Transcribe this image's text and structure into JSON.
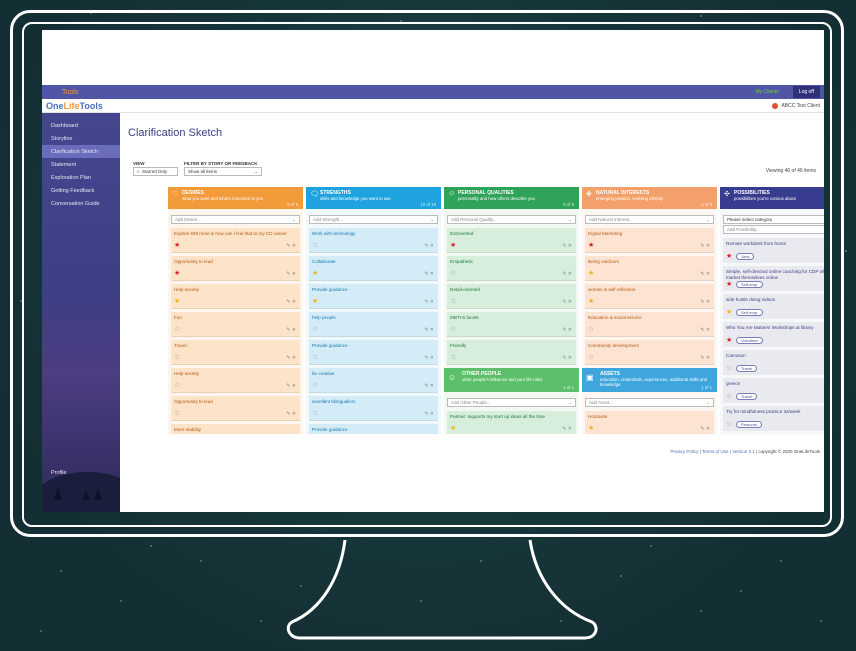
{
  "topbar": {
    "my_clients": "My Clients",
    "logoff": "Log off",
    "swoosh_text": "Tools"
  },
  "brand": {
    "one": "One",
    "life": "Life",
    "tools": "Tools",
    "user": "ABCC Test Client"
  },
  "sidebar": {
    "items": [
      {
        "label": "Dashboard"
      },
      {
        "label": "Storyline"
      },
      {
        "label": "Clarification Sketch"
      },
      {
        "label": "Statement"
      },
      {
        "label": "Exploration Plan"
      },
      {
        "label": "Getting Feedback"
      },
      {
        "label": "Conversation Guide"
      }
    ],
    "profile": "Profile"
  },
  "page": {
    "title": "Clarification Sketch",
    "view_label": "VIEW",
    "filter_label": "FILTER BY STORY OR FEEDBACK",
    "starred_only": "Starred Only",
    "show_all": "Show all items",
    "viewing": "Viewing 46 of 46 items"
  },
  "columns": [
    {
      "title": "DESIRES",
      "subtitle": "what you want and what's important to you",
      "count": "9 of 9",
      "color": "#f39a3a",
      "card_color": "#fde3c8",
      "text_color": "#b55a10",
      "add_placeholder": "Add Desire...",
      "cards": [
        {
          "text": "Explore DM more & how can I link that to my CD career",
          "star": "filled-red"
        },
        {
          "text": "Opportunity to lead",
          "star": "filled-red"
        },
        {
          "text": "Help society",
          "star": "filled-gold"
        },
        {
          "text": "Fun",
          "star": "empty"
        },
        {
          "text": "Travel",
          "star": "empty"
        },
        {
          "text": "Help society",
          "star": "empty"
        },
        {
          "text": "Opportunity to lead",
          "star": "empty"
        },
        {
          "text": "More stability",
          "star": "empty"
        }
      ]
    },
    {
      "title": "STRENGTHS",
      "subtitle": "skills and knowledge you want to use",
      "count": "10 of 10",
      "color": "#1fa3e0",
      "card_color": "#d4ecf8",
      "text_color": "#1577b0",
      "add_placeholder": "Add Strength...",
      "cards": [
        {
          "text": "Work with technology",
          "star": "empty"
        },
        {
          "text": "Collaborate",
          "star": "filled-gold"
        },
        {
          "text": "Provide guidance",
          "star": "filled-gold"
        },
        {
          "text": "help people",
          "star": "empty"
        },
        {
          "text": "Provide guidance",
          "star": "empty"
        },
        {
          "text": "be creative",
          "star": "empty"
        },
        {
          "text": "excellent bilingualism",
          "star": "empty"
        },
        {
          "text": "Provide guidance",
          "star": "empty"
        }
      ]
    },
    {
      "title": "PERSONAL QUALITIES",
      "subtitle": "personality and how others describe you",
      "count": "5 of 5",
      "color": "#2fa35a",
      "card_color": "#d7eedc",
      "text_color": "#1d7a3f",
      "add_placeholder": "Add Personal Quality...",
      "cards": [
        {
          "text": "Extroverted",
          "star": "filled-red"
        },
        {
          "text": "Empathetic",
          "star": "empty"
        },
        {
          "text": "Detail-oriented",
          "star": "empty"
        },
        {
          "text": "MBTI-5 facets",
          "star": "empty"
        },
        {
          "text": "Friendly",
          "star": "empty"
        }
      ],
      "sub": {
        "title": "OTHER PEOPLE",
        "subtitle": "other people's influence and your life roles",
        "count": "1 of 1",
        "color": "#5cbf6a",
        "add_placeholder": "Add Other People...",
        "cards": [
          {
            "text": "Partner: supports my start up ideas all the time",
            "star": "filled-gold"
          }
        ]
      }
    },
    {
      "title": "NATURAL INTERESTS",
      "subtitle": "emerging passion, evolving identity",
      "count": "5 of 5",
      "color": "#f4a06a",
      "card_color": "#fde3d2",
      "text_color": "#b55a10",
      "add_placeholder": "Add Natural Interest...",
      "cards": [
        {
          "text": "Digital Marketing",
          "star": "filled-red"
        },
        {
          "text": "Being outdoors",
          "star": "filled-gold"
        },
        {
          "text": "women & self reflection",
          "star": "filled-gold"
        },
        {
          "text": "Education & social service",
          "star": "empty"
        },
        {
          "text": "Community development",
          "star": "empty"
        }
      ],
      "sub": {
        "title": "ASSETS",
        "subtitle": "education, credentials, experiences, additional skills and knowledge",
        "count": "1 of 1",
        "color": "#3fa6dd",
        "add_placeholder": "Add Asset...",
        "cards": [
          {
            "text": "Hootsuite",
            "star": "filled-gold"
          }
        ]
      }
    },
    {
      "title": "POSSIBILITIES",
      "subtitle": "possibilities you're curious about",
      "count": "8 of 8",
      "color": "#383c8e",
      "card_color": "#e9e9f0",
      "text_color": "#3b3e80",
      "category_placeholder": "Please select category",
      "add_placeholder": "Add Possibility...",
      "cards": [
        {
          "text": "Remote workdesk from home",
          "star": "filled-red",
          "tag": "Jobs"
        },
        {
          "text": "Simple, self-directed online coaching for CDP who want to market themselves online",
          "star": "filled-red",
          "tag": "Self-emp."
        },
        {
          "text": "side hustle doing videos",
          "star": "filled-gold",
          "tag": "Self-emp."
        },
        {
          "text": "Who You Are Matters! Workshops at library",
          "star": "filled-red",
          "tag": "Volunteer"
        },
        {
          "text": "Camosun",
          "star": "empty",
          "tag": "Travel"
        },
        {
          "text": "greece",
          "star": "empty",
          "tag": "Travel"
        },
        {
          "text": "Try for mindfulness practice 3x/week",
          "star": "empty",
          "tag": "Personal"
        }
      ]
    }
  ],
  "footer": {
    "privacy": "Privacy Policy",
    "terms": "Terms of Use",
    "version": "Version 3.1",
    "copyright": "copyright © 2020 OneLifeTools"
  }
}
